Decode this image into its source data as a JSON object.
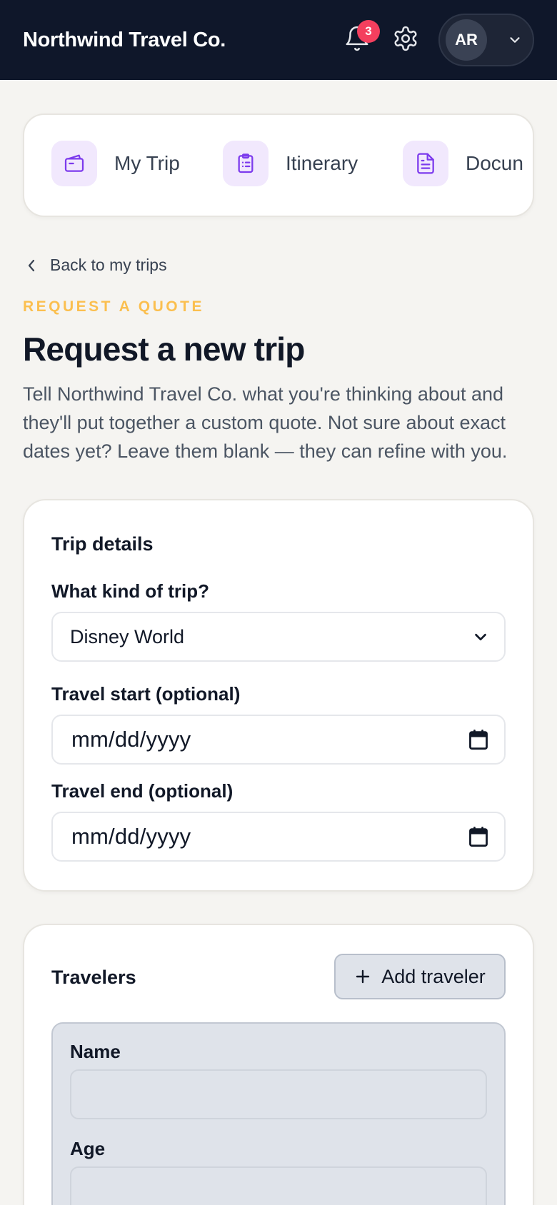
{
  "header": {
    "brand": "Northwind Travel Co.",
    "notification_count": "3",
    "user_initials": "AR",
    "icons": [
      "bell-icon",
      "gear-icon",
      "chevron-down-icon"
    ]
  },
  "nav": {
    "items": [
      {
        "label": "My Trip",
        "icon": "ticket-icon"
      },
      {
        "label": "Itinerary",
        "icon": "clipboard-icon"
      },
      {
        "label": "Docun",
        "icon": "document-icon"
      }
    ]
  },
  "back_link": "Back to my trips",
  "eyebrow": "REQUEST A QUOTE",
  "page_title": "Request a new trip",
  "intro": "Tell Northwind Travel Co. what you're thinking about and they'll put together a custom quote. Not sure about exact dates yet? Leave them blank — they can refine with you.",
  "trip_details": {
    "title": "Trip details",
    "kind_label": "What kind of trip?",
    "kind_value": "Disney World",
    "start_label": "Travel start (optional)",
    "start_placeholder": "mm/dd/yyyy",
    "end_label": "Travel end (optional)",
    "end_placeholder": "mm/dd/yyyy"
  },
  "travelers": {
    "title": "Travelers",
    "add_button": "Add traveler",
    "name_label": "Name",
    "age_label": "Age"
  },
  "colors": {
    "header_bg": "#0f172a",
    "accent_purple": "#7c3aed",
    "eyebrow": "#fbbf4f",
    "badge": "#f43f5e"
  }
}
